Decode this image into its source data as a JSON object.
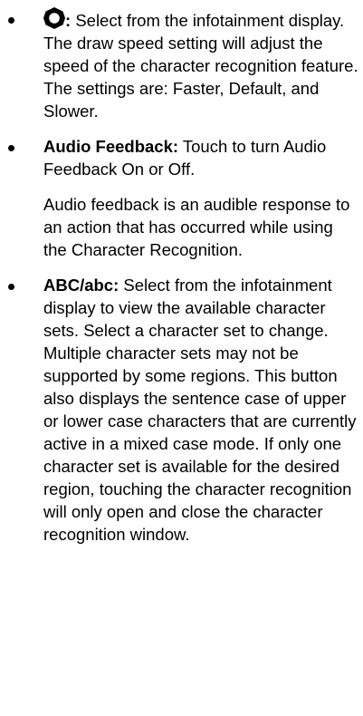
{
  "items": [
    {
      "icon": "settings-gear-icon",
      "term_suffix": ":",
      "text": "Select from the infotainment display. The draw speed setting will adjust the speed of the character recognition feature. The settings are: Faster, Default, and Slower."
    },
    {
      "term": "Audio Feedback:",
      "text": "Touch to turn Audio Feedback On or Off.",
      "subtext": "Audio feedback is an audible response to an action that has occurred while using the Character Recognition."
    },
    {
      "term": "ABC/abc:",
      "text": "Select from the infotainment display to view the available character sets. Select a character set to change. Multiple character sets may not be supported by some regions. This button also displays the sentence case of upper or lower case characters that are currently active in a mixed case mode. If only one character set is available for the desired region, touching the character recognition will only open and close the character recognition window."
    }
  ]
}
